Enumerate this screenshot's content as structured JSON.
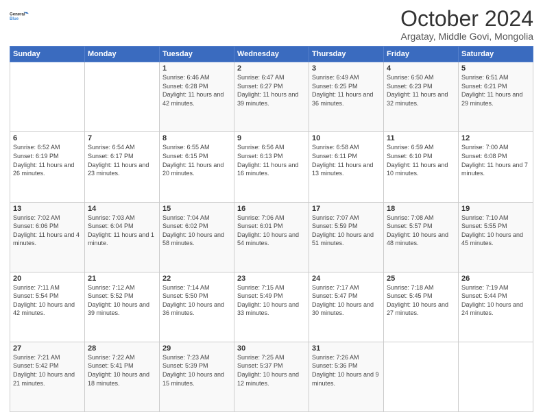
{
  "logo": {
    "line1": "General",
    "line2": "Blue",
    "icon_color": "#4a90d9"
  },
  "header": {
    "month": "October 2024",
    "location": "Argatay, Middle Govi, Mongolia"
  },
  "weekdays": [
    "Sunday",
    "Monday",
    "Tuesday",
    "Wednesday",
    "Thursday",
    "Friday",
    "Saturday"
  ],
  "weeks": [
    [
      {
        "day": "",
        "info": ""
      },
      {
        "day": "",
        "info": ""
      },
      {
        "day": "1",
        "info": "Sunrise: 6:46 AM\nSunset: 6:28 PM\nDaylight: 11 hours and 42 minutes."
      },
      {
        "day": "2",
        "info": "Sunrise: 6:47 AM\nSunset: 6:27 PM\nDaylight: 11 hours and 39 minutes."
      },
      {
        "day": "3",
        "info": "Sunrise: 6:49 AM\nSunset: 6:25 PM\nDaylight: 11 hours and 36 minutes."
      },
      {
        "day": "4",
        "info": "Sunrise: 6:50 AM\nSunset: 6:23 PM\nDaylight: 11 hours and 32 minutes."
      },
      {
        "day": "5",
        "info": "Sunrise: 6:51 AM\nSunset: 6:21 PM\nDaylight: 11 hours and 29 minutes."
      }
    ],
    [
      {
        "day": "6",
        "info": "Sunrise: 6:52 AM\nSunset: 6:19 PM\nDaylight: 11 hours and 26 minutes."
      },
      {
        "day": "7",
        "info": "Sunrise: 6:54 AM\nSunset: 6:17 PM\nDaylight: 11 hours and 23 minutes."
      },
      {
        "day": "8",
        "info": "Sunrise: 6:55 AM\nSunset: 6:15 PM\nDaylight: 11 hours and 20 minutes."
      },
      {
        "day": "9",
        "info": "Sunrise: 6:56 AM\nSunset: 6:13 PM\nDaylight: 11 hours and 16 minutes."
      },
      {
        "day": "10",
        "info": "Sunrise: 6:58 AM\nSunset: 6:11 PM\nDaylight: 11 hours and 13 minutes."
      },
      {
        "day": "11",
        "info": "Sunrise: 6:59 AM\nSunset: 6:10 PM\nDaylight: 11 hours and 10 minutes."
      },
      {
        "day": "12",
        "info": "Sunrise: 7:00 AM\nSunset: 6:08 PM\nDaylight: 11 hours and 7 minutes."
      }
    ],
    [
      {
        "day": "13",
        "info": "Sunrise: 7:02 AM\nSunset: 6:06 PM\nDaylight: 11 hours and 4 minutes."
      },
      {
        "day": "14",
        "info": "Sunrise: 7:03 AM\nSunset: 6:04 PM\nDaylight: 11 hours and 1 minute."
      },
      {
        "day": "15",
        "info": "Sunrise: 7:04 AM\nSunset: 6:02 PM\nDaylight: 10 hours and 58 minutes."
      },
      {
        "day": "16",
        "info": "Sunrise: 7:06 AM\nSunset: 6:01 PM\nDaylight: 10 hours and 54 minutes."
      },
      {
        "day": "17",
        "info": "Sunrise: 7:07 AM\nSunset: 5:59 PM\nDaylight: 10 hours and 51 minutes."
      },
      {
        "day": "18",
        "info": "Sunrise: 7:08 AM\nSunset: 5:57 PM\nDaylight: 10 hours and 48 minutes."
      },
      {
        "day": "19",
        "info": "Sunrise: 7:10 AM\nSunset: 5:55 PM\nDaylight: 10 hours and 45 minutes."
      }
    ],
    [
      {
        "day": "20",
        "info": "Sunrise: 7:11 AM\nSunset: 5:54 PM\nDaylight: 10 hours and 42 minutes."
      },
      {
        "day": "21",
        "info": "Sunrise: 7:12 AM\nSunset: 5:52 PM\nDaylight: 10 hours and 39 minutes."
      },
      {
        "day": "22",
        "info": "Sunrise: 7:14 AM\nSunset: 5:50 PM\nDaylight: 10 hours and 36 minutes."
      },
      {
        "day": "23",
        "info": "Sunrise: 7:15 AM\nSunset: 5:49 PM\nDaylight: 10 hours and 33 minutes."
      },
      {
        "day": "24",
        "info": "Sunrise: 7:17 AM\nSunset: 5:47 PM\nDaylight: 10 hours and 30 minutes."
      },
      {
        "day": "25",
        "info": "Sunrise: 7:18 AM\nSunset: 5:45 PM\nDaylight: 10 hours and 27 minutes."
      },
      {
        "day": "26",
        "info": "Sunrise: 7:19 AM\nSunset: 5:44 PM\nDaylight: 10 hours and 24 minutes."
      }
    ],
    [
      {
        "day": "27",
        "info": "Sunrise: 7:21 AM\nSunset: 5:42 PM\nDaylight: 10 hours and 21 minutes."
      },
      {
        "day": "28",
        "info": "Sunrise: 7:22 AM\nSunset: 5:41 PM\nDaylight: 10 hours and 18 minutes."
      },
      {
        "day": "29",
        "info": "Sunrise: 7:23 AM\nSunset: 5:39 PM\nDaylight: 10 hours and 15 minutes."
      },
      {
        "day": "30",
        "info": "Sunrise: 7:25 AM\nSunset: 5:37 PM\nDaylight: 10 hours and 12 minutes."
      },
      {
        "day": "31",
        "info": "Sunrise: 7:26 AM\nSunset: 5:36 PM\nDaylight: 10 hours and 9 minutes."
      },
      {
        "day": "",
        "info": ""
      },
      {
        "day": "",
        "info": ""
      }
    ]
  ]
}
